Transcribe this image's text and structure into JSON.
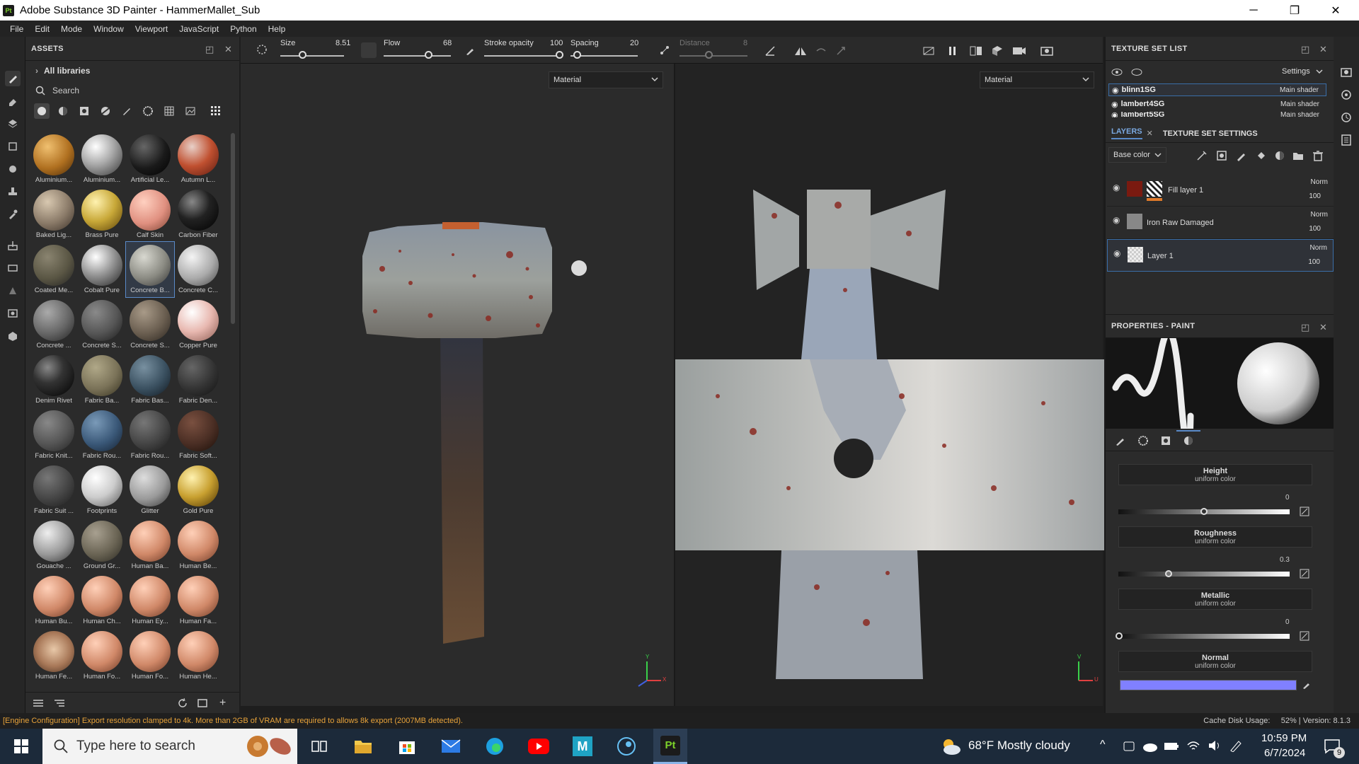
{
  "window": {
    "app_badge": "Pt",
    "title": "Adobe Substance 3D Painter - HammerMallet_Sub",
    "minimize": "─",
    "maximize": "❐",
    "close": "✕"
  },
  "menu": [
    "File",
    "Edit",
    "Mode",
    "Window",
    "Viewport",
    "JavaScript",
    "Python",
    "Help"
  ],
  "assets": {
    "title": "ASSETS",
    "breadcrumb": "All libraries",
    "search_placeholder": "Search",
    "materials": [
      {
        "label": "Aluminium..."
      },
      {
        "label": "Aluminium..."
      },
      {
        "label": "Artificial Le..."
      },
      {
        "label": "Autumn L..."
      },
      {
        "label": "Baked Lig..."
      },
      {
        "label": "Brass Pure"
      },
      {
        "label": "Calf Skin"
      },
      {
        "label": "Carbon Fiber"
      },
      {
        "label": "Coated Me..."
      },
      {
        "label": "Cobalt Pure"
      },
      {
        "label": "Concrete B..."
      },
      {
        "label": "Concrete C..."
      },
      {
        "label": "Concrete ..."
      },
      {
        "label": "Concrete S..."
      },
      {
        "label": "Concrete S..."
      },
      {
        "label": "Copper Pure"
      },
      {
        "label": "Denim Rivet"
      },
      {
        "label": "Fabric Ba..."
      },
      {
        "label": "Fabric Bas..."
      },
      {
        "label": "Fabric Den..."
      },
      {
        "label": "Fabric Knit..."
      },
      {
        "label": "Fabric Rou..."
      },
      {
        "label": "Fabric Rou..."
      },
      {
        "label": "Fabric Soft..."
      },
      {
        "label": "Fabric Suit ..."
      },
      {
        "label": "Footprints"
      },
      {
        "label": "Glitter"
      },
      {
        "label": "Gold Pure"
      },
      {
        "label": "Gouache ..."
      },
      {
        "label": "Ground Gr..."
      },
      {
        "label": "Human Ba..."
      },
      {
        "label": "Human Be..."
      },
      {
        "label": "Human Bu..."
      },
      {
        "label": "Human Ch..."
      },
      {
        "label": "Human Ey..."
      },
      {
        "label": "Human Fa..."
      },
      {
        "label": "Human Fe..."
      },
      {
        "label": "Human Fo..."
      },
      {
        "label": "Human Fo..."
      },
      {
        "label": "Human He..."
      }
    ]
  },
  "toolbar": {
    "size_label": "Size",
    "size_value": "8.51",
    "flow_label": "Flow",
    "flow_value": "68",
    "stroke_opacity_label": "Stroke opacity",
    "stroke_opacity_value": "100",
    "spacing_label": "Spacing",
    "spacing_value": "20",
    "distance_label": "Distance",
    "distance_value": "8"
  },
  "viewports": {
    "left_mode": "Material",
    "right_mode": "Material",
    "axis_y": "Y",
    "axis_x": "X",
    "axis_u": "U",
    "axis_v": "V"
  },
  "texture_set_list": {
    "title": "TEXTURE SET LIST",
    "settings_label": "Settings",
    "items": [
      {
        "name": "blinn1SG",
        "shader": "Main shader"
      },
      {
        "name": "lambert4SG",
        "shader": "Main shader"
      },
      {
        "name": "lambert5SG",
        "shader": "Main shader"
      }
    ]
  },
  "layers": {
    "tab_layers": "LAYERS",
    "tab_settings": "TEXTURE SET SETTINGS",
    "channel": "Base color",
    "items": [
      {
        "name": "Fill layer 1",
        "blend": "Norm",
        "opacity": "100"
      },
      {
        "name": "Iron Raw Damaged",
        "blend": "Norm",
        "opacity": "100"
      },
      {
        "name": "Layer 1",
        "blend": "Norm",
        "opacity": "100"
      }
    ]
  },
  "properties": {
    "title": "PROPERTIES - PAINT",
    "height": {
      "title": "Height",
      "sub": "uniform color",
      "value": "0"
    },
    "roughness": {
      "title": "Roughness",
      "sub": "uniform color",
      "value": "0.3"
    },
    "metallic": {
      "title": "Metallic",
      "sub": "uniform color",
      "value": "0"
    },
    "normal": {
      "title": "Normal",
      "sub": "uniform color",
      "color": "#8080ff"
    }
  },
  "status": {
    "message": "[Engine Configuration] Export resolution clamped to 4k. More than 2GB of VRAM are required to allows 8k export (2007MB detected).",
    "cache_label": "Cache Disk Usage:",
    "cache_value": "52% | Version: 8.1.3"
  },
  "taskbar": {
    "search_placeholder": "Type here to search",
    "weather": "68°F  Mostly cloudy",
    "time": "10:59 PM",
    "date": "6/7/2024",
    "notifications": "9",
    "maya_label": "M",
    "pt_label": "Pt"
  }
}
